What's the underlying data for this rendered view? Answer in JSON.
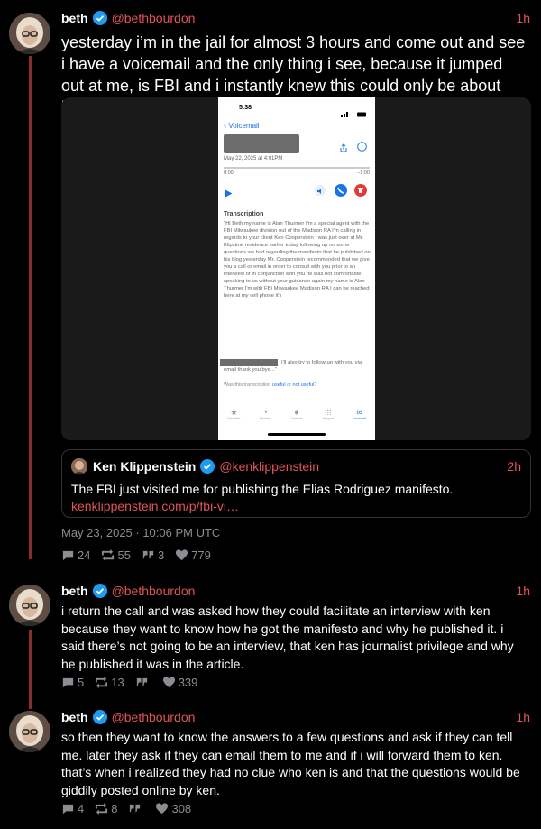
{
  "posts": [
    {
      "name": "beth",
      "handle": "@bethbourdon",
      "time": "1h",
      "text": "yesterday i’m in the jail for almost 3 hours and come out and see i have a voicemail and the only thing i see, because it jumped out at me, is FBI and i instantly knew this could only be about ken.",
      "date": "May 23, 2025 · 10:06 PM UTC",
      "replies": "24",
      "reposts": "55",
      "quotes": "3",
      "likes": "779"
    },
    {
      "name": "beth",
      "handle": "@bethbourdon",
      "time": "1h",
      "text": "i return the call and was asked how they could facilitate an interview with ken because they want to know how he got the manifesto and why he published it. i said there’s not going to be an interview, that ken has journalist privilege and why he published it was in the article.",
      "replies": "5",
      "reposts": "13",
      "quotes": "",
      "likes": "339"
    },
    {
      "name": "beth",
      "handle": "@bethbourdon",
      "time": "1h",
      "text": "so then they want to know the answers to a few questions and ask if they can tell me. later they ask if they can email them to me and if i will forward them to ken. that’s when i realized they had no clue who ken is and that the questions would be giddily posted online by ken.",
      "replies": "4",
      "reposts": "8",
      "quotes": "",
      "likes": "308"
    }
  ],
  "quote": {
    "name": "Ken Klippenstein",
    "handle": "@kenklippenstein",
    "time": "2h",
    "text": "The FBI just visited me for publishing the Elias Rodriguez manifesto.",
    "link": "kenklippenstein.com/p/fbi-vi…"
  },
  "voicemail": {
    "status_time": "5:38",
    "back_label": "Voicemail",
    "date": "May 22, 2025 at 4:01PM",
    "elapsed": "0:00",
    "remaining": "−1:00",
    "transcription_title": "Transcription",
    "transcription": "\"Hi Beth my name is Alan Thurmer I'm a special agent with the FBI Milwaukee division out of the Madison RA I'm calling in regards to your client Ken Cooperstein I was just over at Mr. Klipstine residence earlier today following up on some questions we had regarding the manifesto that he published on his blog yesterday Mr. Cooperstein recommended that we give you a call or email in order to consult with you prior to an interview or in conjunction with you he was not comfortable speaking to us without your guidance again my name is Alan Thurmer I'm with FBI Milwaukee Madison RA I can be reached here at my cell phone it's",
    "transcription_end": "I'll also try to follow up with you via email thank you bye...\"",
    "feedback_prefix": "Was this transcription",
    "useful": "useful",
    "or": "or",
    "not_useful": "not useful",
    "tabs": [
      "Favorites",
      "Recents",
      "Contacts",
      "Keypad",
      "Voicemail"
    ]
  },
  "colors": {
    "accent": "#e0555a",
    "thread": "#8b2c2c",
    "verified": "#1d9bf0",
    "muted": "#8a8d91"
  }
}
